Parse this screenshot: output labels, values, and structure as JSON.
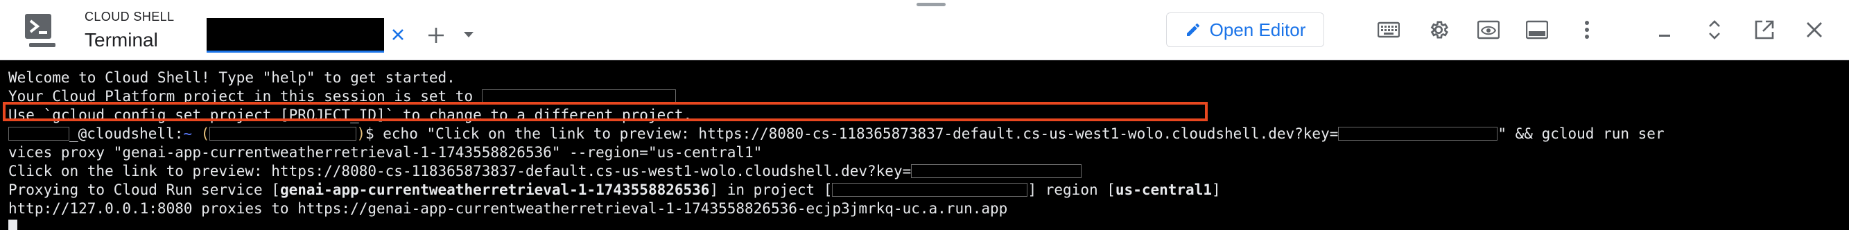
{
  "header": {
    "brand_small": "CLOUD SHELL",
    "brand_title": "Terminal",
    "tab_name": "",
    "open_editor_label": "Open Editor",
    "accent": "#1a73e8"
  },
  "icons": {
    "shell": "cloud-shell-icon",
    "tab_close": "close-icon",
    "add_tab": "plus-icon",
    "tab_menu": "chevron-down-icon",
    "editor": "pencil-icon",
    "keyboard": "keyboard-icon",
    "settings": "gear-icon",
    "preview": "web-preview-icon",
    "layout": "panel-layout-icon",
    "more": "more-vert-icon",
    "minimize": "minimize-icon",
    "restore": "expand-collapse-icon",
    "open_new_window": "open-in-new-icon",
    "close": "close-icon"
  },
  "terminal": {
    "line1": "Welcome to Cloud Shell! Type \"help\" to get started.",
    "line2": "Your Cloud Platform project in this session is set to ",
    "line3": "Use `gcloud config set project [PROJECT_ID]` to change to a different project.",
    "line4_user_suffix": "_@cloudshell:",
    "line4_tilde": "~",
    "line4_paren_open": " (",
    "line4_paren_close": ")",
    "line4_cmd": "$ echo \"Click on the link to preview: https://8080-cs-118365873837-default.cs-us-west1-wolo.cloudshell.dev?key=",
    "line4_cmd_tail": "\" && gcloud run ser",
    "line5": "vices proxy \"genai-app-currentweatherretrieval-1-1743558826536\" --region=\"us-central1\"",
    "line6": "Click on the link to preview: https://8080-cs-118365873837-default.cs-us-west1-wolo.cloudshell.dev?key=",
    "line7_prefix": "Proxying to Cloud Run service [",
    "line7_service": "genai-app-currentweatherretrieval-1-1743558826536",
    "line7_mid": "] in project [",
    "line7_region_prefix": "] region [",
    "line7_region": "us-central1",
    "line7_suffix": "]",
    "line8": "http://127.0.0.1:8080 proxies to https://genai-app-currentweatherretrieval-1-1743558826536-ecjp3jmrkq-uc.a.run.app"
  }
}
